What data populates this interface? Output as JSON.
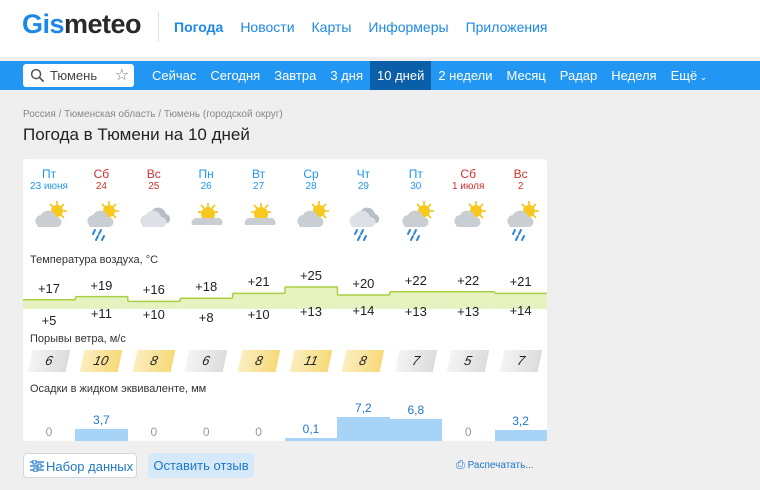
{
  "logo": {
    "part1": "Gis",
    "part2": "meteo"
  },
  "topnav": [
    "Погода",
    "Новости",
    "Карты",
    "Информеры",
    "Приложения"
  ],
  "search": {
    "city": "Тюмень"
  },
  "tabs": [
    "Сейчас",
    "Сегодня",
    "Завтра",
    "3 дня",
    "10 дней",
    "2 недели",
    "Месяц",
    "Радар",
    "Неделя",
    "Ещё"
  ],
  "active_tab": "10 дней",
  "breadcrumb": "Россия / Тюменская область / Тюмень (городской округ)",
  "title": "Погода в Тюмени на 10 дней",
  "labels": {
    "temperature": "Температура воздуха, °C",
    "wind": "Порывы ветра, м/с",
    "precip": "Осадки в жидком эквиваленте, мм"
  },
  "days": [
    {
      "name": "Пт",
      "date": "23 июня",
      "weekend": false,
      "icon": "partly-cloudy",
      "tmax": "+17",
      "tmin": "+5",
      "wind": "6",
      "precip": "0"
    },
    {
      "name": "Сб",
      "date": "24",
      "weekend": true,
      "icon": "partly-cloudy-rain",
      "tmax": "+19",
      "tmin": "+11",
      "wind": "10",
      "precip": "3,7"
    },
    {
      "name": "Вс",
      "date": "25",
      "weekend": true,
      "icon": "cloudy",
      "tmax": "+16",
      "tmin": "+10",
      "wind": "8",
      "precip": "0"
    },
    {
      "name": "Пн",
      "date": "26",
      "weekend": false,
      "icon": "sunny-cloud",
      "tmax": "+18",
      "tmin": "+8",
      "wind": "6",
      "precip": "0"
    },
    {
      "name": "Вт",
      "date": "27",
      "weekend": false,
      "icon": "sunny-cloud",
      "tmax": "+21",
      "tmin": "+10",
      "wind": "8",
      "precip": "0"
    },
    {
      "name": "Ср",
      "date": "28",
      "weekend": false,
      "icon": "partly-cloudy",
      "tmax": "+25",
      "tmin": "+13",
      "wind": "11",
      "precip": "0,1"
    },
    {
      "name": "Чт",
      "date": "29",
      "weekend": false,
      "icon": "cloudy-rain",
      "tmax": "+20",
      "tmin": "+14",
      "wind": "8",
      "precip": "7,2"
    },
    {
      "name": "Пт",
      "date": "30",
      "weekend": false,
      "icon": "partly-cloudy-rain",
      "tmax": "+22",
      "tmin": "+13",
      "wind": "7",
      "precip": "6,8"
    },
    {
      "name": "Сб",
      "date": "1 июля",
      "weekend": true,
      "icon": "partly-cloudy",
      "tmax": "+22",
      "tmin": "+13",
      "wind": "5",
      "precip": "0"
    },
    {
      "name": "Вс",
      "date": "2",
      "weekend": true,
      "icon": "partly-cloudy-rain",
      "tmax": "+21",
      "tmin": "+14",
      "wind": "7",
      "precip": "3,2"
    }
  ],
  "buttons": {
    "dataset": "Набор данных",
    "feedback": "Оставить отзыв",
    "print": "Распечатать..."
  },
  "colors": {
    "accent": "#2196f3",
    "active_tab": "#0b5ea8",
    "weekend": "#d03030",
    "precip_bar": "#a6d3f6",
    "temp_band": "#e4f2bd"
  }
}
